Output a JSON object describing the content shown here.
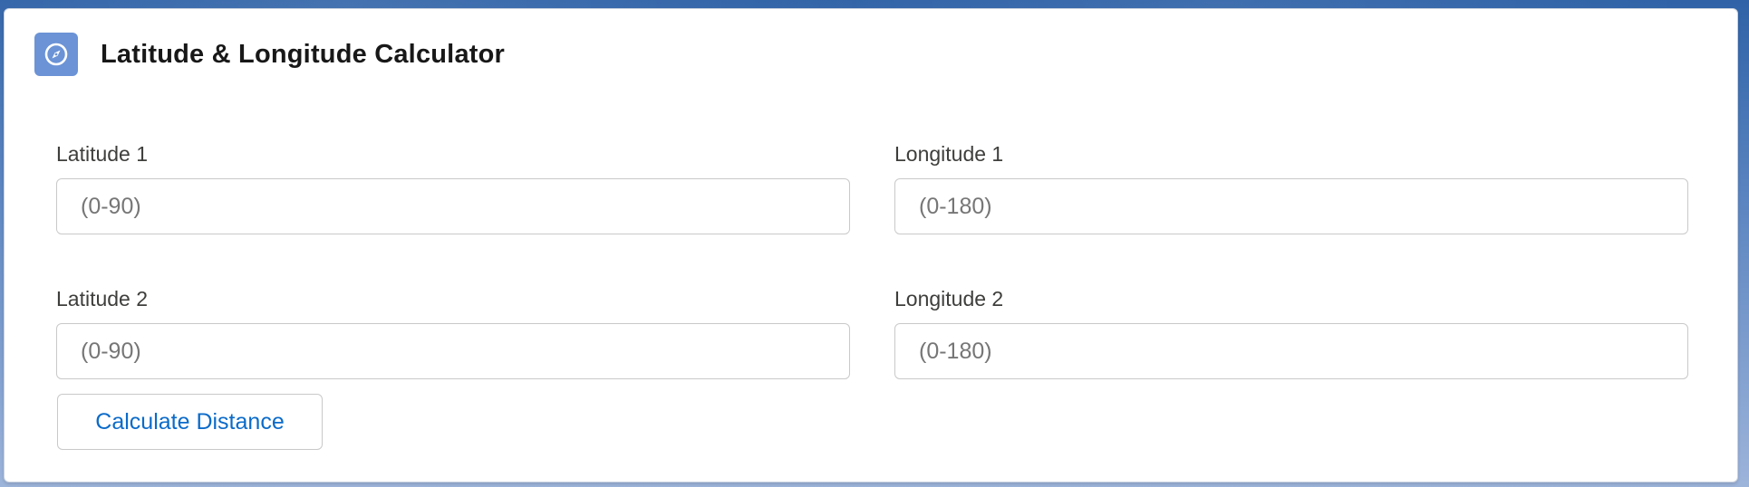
{
  "card": {
    "title": "Latitude & Longitude Calculator",
    "icon": "compass-icon",
    "accent_color": "#6b93d6"
  },
  "fields": {
    "latitude1": {
      "label": "Latitude 1",
      "placeholder": "(0-90)",
      "value": ""
    },
    "longitude1": {
      "label": "Longitude 1",
      "placeholder": "(0-180)",
      "value": ""
    },
    "latitude2": {
      "label": "Latitude 2",
      "placeholder": "(0-90)",
      "value": ""
    },
    "longitude2": {
      "label": "Longitude 2",
      "placeholder": "(0-180)",
      "value": ""
    }
  },
  "actions": {
    "calculate_label": "Calculate Distance",
    "button_text_color": "#0b6bc9"
  }
}
